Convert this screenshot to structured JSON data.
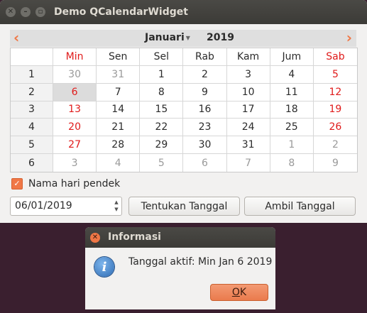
{
  "window": {
    "title": "Demo QCalendarWidget"
  },
  "calendar": {
    "prev_icon": "chevron-left-icon",
    "next_icon": "chevron-right-icon",
    "month": "Januari",
    "year": "2019",
    "headers": [
      "",
      "Min",
      "Sen",
      "Sel",
      "Rab",
      "Kam",
      "Jum",
      "Sab"
    ],
    "rows": [
      {
        "week": "1",
        "days": [
          "30",
          "31",
          "1",
          "2",
          "3",
          "4",
          "5"
        ]
      },
      {
        "week": "2",
        "days": [
          "6",
          "7",
          "8",
          "9",
          "10",
          "11",
          "12"
        ]
      },
      {
        "week": "3",
        "days": [
          "13",
          "14",
          "15",
          "16",
          "17",
          "18",
          "19"
        ]
      },
      {
        "week": "4",
        "days": [
          "20",
          "21",
          "22",
          "23",
          "24",
          "25",
          "26"
        ]
      },
      {
        "week": "5",
        "days": [
          "27",
          "28",
          "29",
          "30",
          "31",
          "1",
          "2"
        ]
      },
      {
        "week": "6",
        "days": [
          "3",
          "4",
          "5",
          "6",
          "7",
          "8",
          "9"
        ]
      }
    ],
    "selected": "6"
  },
  "controls": {
    "short_names_checkbox": "Nama hari pendek",
    "short_names_checked": true,
    "date_value": "06/01/2019",
    "set_button": "Tentukan Tanggal",
    "get_button": "Ambil Tanggal"
  },
  "dialog": {
    "title": "Informasi",
    "message": "Tanggal aktif: Min Jan 6 2019",
    "ok_prefix": "O",
    "ok_rest": "K"
  },
  "colors": {
    "accent": "#f07746",
    "weekend": "#e01b1b",
    "dimmed": "#9a9a9a"
  }
}
